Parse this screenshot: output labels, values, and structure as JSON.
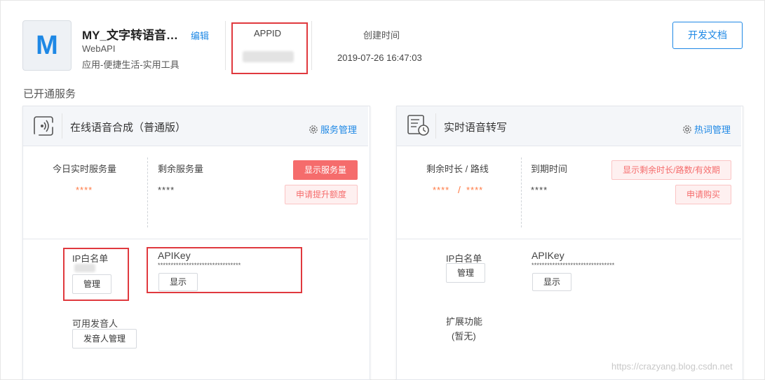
{
  "app": {
    "logo_letter": "M",
    "name": "MY_文字转语音…",
    "edit_label": "编辑",
    "type": "WebAPI",
    "category": "应用-便捷生活-实用工具",
    "appid_label": "APPID",
    "created_label": "创建时间",
    "created_value": "2019-07-26 16:47:03",
    "doc_button": "开发文档"
  },
  "section_title": "已开通服务",
  "card1": {
    "title": "在线语音合成（普通版）",
    "manage_link": "服务管理",
    "today_label": "今日实时服务量",
    "today_value": "****",
    "remain_label": "剩余服务量",
    "remain_value": "****",
    "show_button": "显示服务量",
    "raise_button": "申请提升额度",
    "ip_label": "IP白名单",
    "ip_manage": "管理",
    "apikey_label": "APIKey",
    "apikey_value": "********************************",
    "apikey_show": "显示",
    "speaker_label": "可用发音人",
    "speaker_button": "发音人管理"
  },
  "card2": {
    "title": "实时语音转写",
    "manage_link": "热词管理",
    "remain_label": "剩余时长 / 路线",
    "remain_value_a": "****",
    "remain_sep": "/",
    "remain_value_b": "****",
    "expire_label": "到期时间",
    "expire_value": "****",
    "show_button": "显示剩余时长/路数/有效期",
    "buy_button": "申请购买",
    "ip_label": "IP白名单",
    "ip_manage": "管理",
    "apikey_label": "APIKey",
    "apikey_value": "********************************",
    "apikey_show": "显示",
    "ext_label": "扩展功能",
    "ext_value": "(暂无)"
  },
  "watermark": "https://crazyang.blog.csdn.net",
  "colors": {
    "accent": "#1e88e5",
    "danger": "#f56c6c",
    "highlight": "#e0393e",
    "orange": "#ff7a45"
  },
  "icons": [
    "speaker-wave-icon",
    "transcript-clock-icon",
    "gear-icon"
  ]
}
